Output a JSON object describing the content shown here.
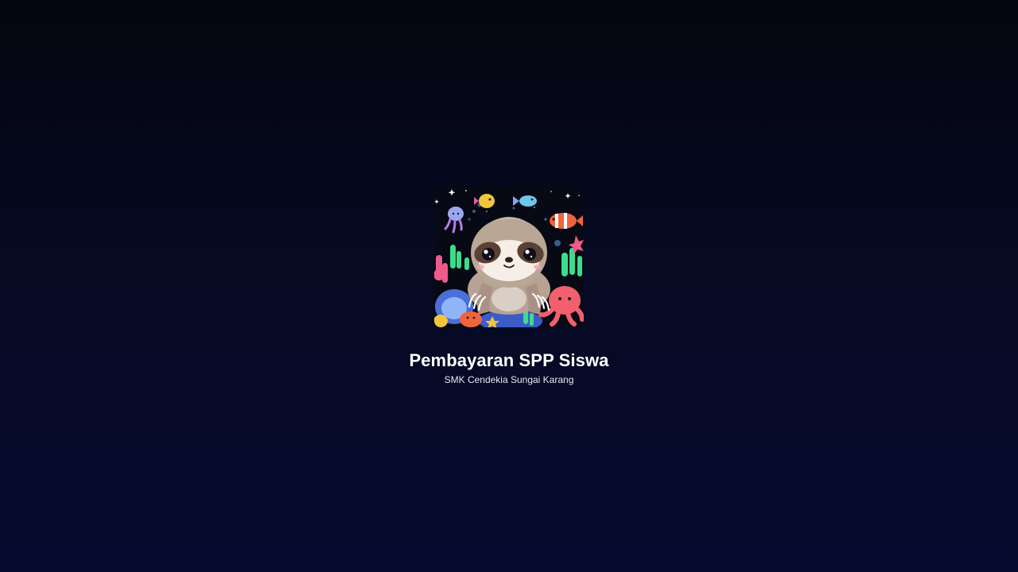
{
  "splash": {
    "logo_icon": "sloth-underwater-illustration-icon",
    "title": "Pembayaran SPP Siswa",
    "subtitle": "SMK Cendekia Sungai Karang"
  },
  "colors": {
    "background_top": "#04050f",
    "background_bottom": "#050a2e",
    "title": "#ffffff",
    "subtitle": "#e6e8f2"
  }
}
